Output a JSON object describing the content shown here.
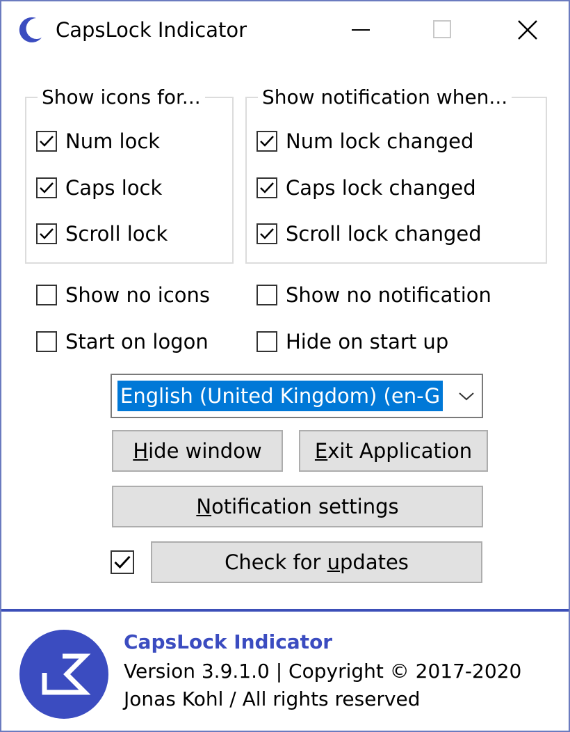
{
  "window": {
    "title": "CapsLock Indicator"
  },
  "groups": {
    "icons": {
      "legend": "Show icons for...",
      "items": [
        {
          "label": "Num lock",
          "checked": true
        },
        {
          "label": "Caps lock",
          "checked": true
        },
        {
          "label": "Scroll lock",
          "checked": true
        }
      ]
    },
    "notifications": {
      "legend": "Show notification when...",
      "items": [
        {
          "label": "Num lock changed",
          "checked": true
        },
        {
          "label": "Caps lock changed",
          "checked": true
        },
        {
          "label": "Scroll lock changed",
          "checked": true
        }
      ]
    }
  },
  "options": {
    "show_no_icons": {
      "label": "Show no icons",
      "checked": false
    },
    "start_on_logon": {
      "label": "Start on logon",
      "checked": false
    },
    "show_no_notification": {
      "label": "Show no notification",
      "checked": false
    },
    "hide_on_start_up": {
      "label": "Hide on start up",
      "checked": false
    }
  },
  "language": {
    "selected": "English (United Kingdom) (en-G"
  },
  "buttons": {
    "hide_window": {
      "mnemonic": "H",
      "rest": "ide window"
    },
    "exit_application": {
      "mnemonic": "E",
      "rest": "xit Application"
    },
    "notification_settings": {
      "mnemonic": "N",
      "rest": "otification settings"
    },
    "check_for_updates": {
      "pre": "Check for ",
      "mnemonic": "u",
      "rest": "pdates"
    },
    "check_for_updates_checkbox_checked": true
  },
  "footer": {
    "app_name": "CapsLock Indicator",
    "version": "Version 3.9.1.0 | Copyright © 2017-2020",
    "rights": "Jonas Kohl / All rights reserved"
  },
  "colors": {
    "accent": "#3b4cc0",
    "selection": "#0078d7",
    "button_face": "#e1e1e1"
  }
}
